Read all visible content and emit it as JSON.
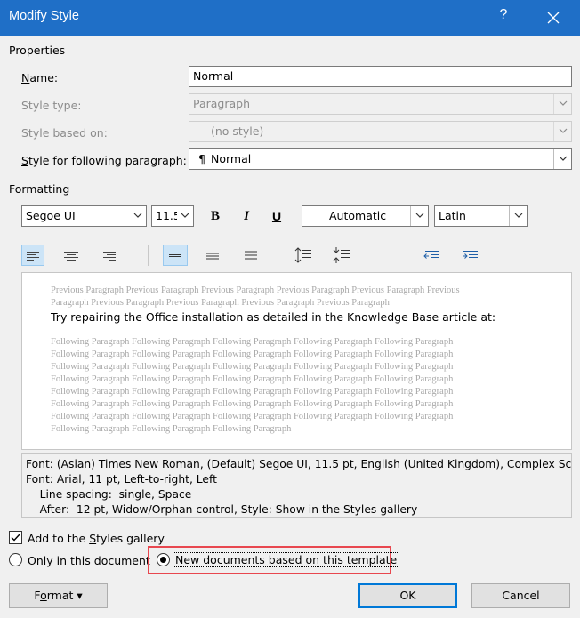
{
  "window": {
    "title": "Modify Style",
    "help_label": "?"
  },
  "properties": {
    "section_label": "Properties",
    "name_label_key": "N",
    "name_label_rest": "ame:",
    "name_value": "Normal",
    "style_type_label": "Style type:",
    "style_type_value": "Paragraph",
    "based_on_label": "Style based on:",
    "based_on_value": "(no style)",
    "following_label_key": "S",
    "following_label_rest": "tyle for following paragraph:",
    "following_symbol": "¶",
    "following_value": "Normal"
  },
  "formatting": {
    "section_label": "Formatting",
    "font": "Segoe UI",
    "size": "11.5",
    "bold": "B",
    "italic": "I",
    "underline": "U",
    "color": "Automatic",
    "script": "Latin"
  },
  "preview": {
    "previous_lines": [
      "Previous Paragraph Previous Paragraph Previous Paragraph Previous Paragraph Previous Paragraph Previous",
      "Paragraph Previous Paragraph Previous Paragraph Previous Paragraph Previous Paragraph"
    ],
    "sample_text": "Try repairing the Office installation as detailed in the Knowledge Base article at:",
    "following_lines": [
      "Following Paragraph Following Paragraph Following Paragraph Following Paragraph Following Paragraph",
      "Following Paragraph Following Paragraph Following Paragraph Following Paragraph Following Paragraph",
      "Following Paragraph Following Paragraph Following Paragraph Following Paragraph Following Paragraph",
      "Following Paragraph Following Paragraph Following Paragraph Following Paragraph Following Paragraph",
      "Following Paragraph Following Paragraph Following Paragraph Following Paragraph Following Paragraph",
      "Following Paragraph Following Paragraph Following Paragraph Following Paragraph Following Paragraph",
      "Following Paragraph Following Paragraph Following Paragraph Following Paragraph Following Paragraph",
      "Following Paragraph Following Paragraph Following Paragraph"
    ]
  },
  "description": {
    "lines": [
      "Font: (Asian) Times New Roman, (Default) Segoe UI, 11.5 pt, English (United Kingdom), Complex Script",
      "Font: Arial, 11 pt, Left-to-right, Left",
      "    Line spacing:  single, Space",
      "    After:  12 pt, Widow/Orphan control, Style: Show in the Styles gallery"
    ]
  },
  "options": {
    "add_gallery_pre": "Add to the ",
    "add_gallery_key": "S",
    "add_gallery_post": "tyles gallery",
    "add_gallery_checked": true,
    "only_doc_label": "Only in this document",
    "new_docs_label": "New documents based on this template",
    "selected": "new_docs"
  },
  "buttons": {
    "format_key": "o",
    "format_pre": "F",
    "format_post": "rmat",
    "format_arrow": "▾",
    "ok": "OK",
    "cancel": "Cancel"
  },
  "colors": {
    "titlebar": "#1f6fc7",
    "highlight": "#e8474f",
    "active_button": "#cce4f7",
    "default_button_border": "#0078d7"
  }
}
